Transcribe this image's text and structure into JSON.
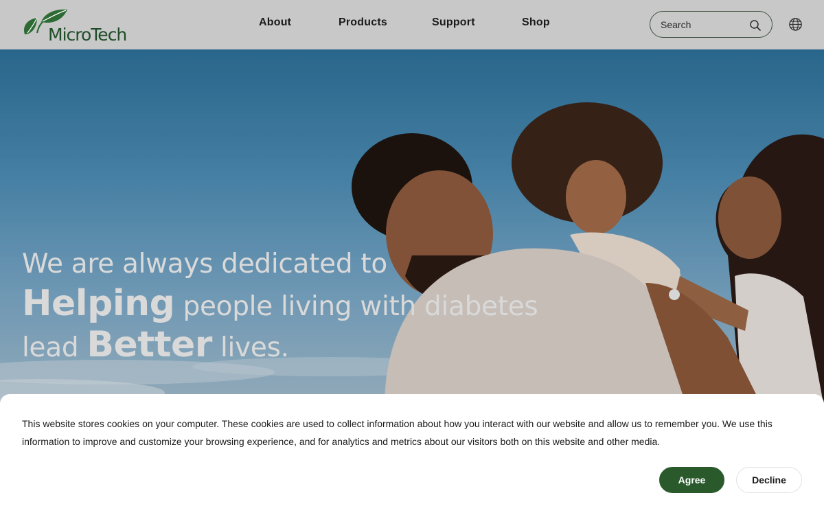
{
  "brand": {
    "name": "MicroTech",
    "color": "#1f4d28"
  },
  "nav": {
    "items": [
      {
        "label": "About"
      },
      {
        "label": "Products"
      },
      {
        "label": "Support"
      },
      {
        "label": "Shop"
      }
    ]
  },
  "search": {
    "placeholder": "Search",
    "icon": "search-icon"
  },
  "language": {
    "icon": "globe-icon"
  },
  "hero": {
    "line1": "We are always dedicated to",
    "strong1": "Helping",
    "line2_rest": " people living with diabetes",
    "line3_lead": "lead ",
    "strong2": "Better",
    "line3_rest": " lives."
  },
  "cookie": {
    "text": "This website stores cookies on your computer. These cookies are used to collect information about how you interact with our website and allow us to remember you. We use this information to improve and customize your browsing experience, and for analytics and metrics about our visitors both on this website and other media.",
    "agree_label": "Agree",
    "decline_label": "Decline",
    "agree_color": "#2a5a2c"
  }
}
